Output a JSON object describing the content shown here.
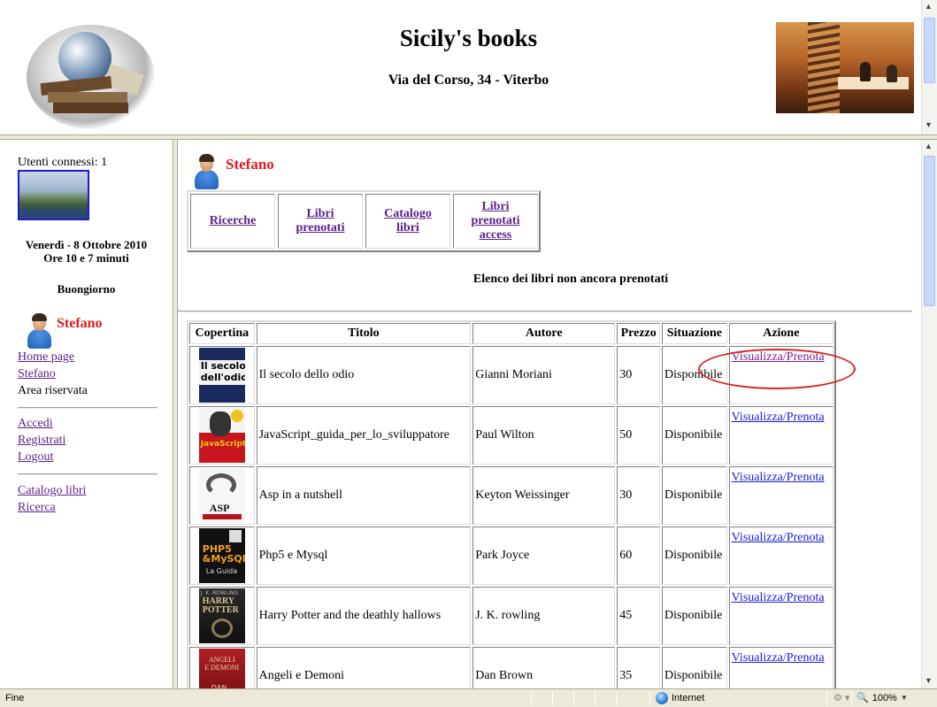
{
  "header": {
    "title": "Sicily's books",
    "address": "Via del Corso, 34 - Viterbo"
  },
  "sidebar": {
    "users_online": "Utenti connessi: 1",
    "date_line1": "Venerdì - 8 Ottobre 2010",
    "date_line2": "Ore 10 e 7 minuti",
    "greeting": "Buongiorno",
    "username": "Stefano",
    "links": {
      "home": "Home page",
      "user": "Stefano",
      "reserved": "Area riservata",
      "login": "Accedi",
      "register": "Registrati",
      "logout": "Logout",
      "catalog": "Catalogo libri",
      "search": "Ricerca"
    }
  },
  "main": {
    "username": "Stefano",
    "menu": [
      {
        "label": "Ricerche"
      },
      {
        "label": "Libri prenotati"
      },
      {
        "label": "Catalogo libri"
      },
      {
        "label": "Libri prenotati access"
      }
    ],
    "heading": "Elenco dei libri non ancora prenotati",
    "table": {
      "headers": [
        "Copertina",
        "Titolo",
        "Autore",
        "Prezzo",
        "Situazione",
        "Azione"
      ],
      "rows": [
        {
          "title": "Il secolo dello odio",
          "author": "Gianni Moriani",
          "price": "30",
          "status": "Disponibile",
          "action": "Visualizza/Prenota",
          "cover": "Il secolo dell'odio"
        },
        {
          "title": "JavaScript_guida_per_lo_sviluppatore",
          "author": "Paul Wilton",
          "price": "50",
          "status": "Disponibile",
          "action": "Visualizza/Prenota",
          "cover": "JavaScript"
        },
        {
          "title": "Asp in a nutshell",
          "author": "Keyton Weissinger",
          "price": "30",
          "status": "Disponibile",
          "action": "Visualizza/Prenota",
          "cover": "ASP"
        },
        {
          "title": "Php5 e Mysql",
          "author": "Park Joyce",
          "price": "60",
          "status": "Disponibile",
          "action": "Visualizza/Prenota",
          "cover": "PHP5 & MySQL"
        },
        {
          "title": "Harry Potter and the deathly hallows",
          "author": "J. K. rowling",
          "price": "45",
          "status": "Disponibile",
          "action": "Visualizza/Prenota",
          "cover": "HARRY POTTER"
        },
        {
          "title": "Angeli e Demoni",
          "author": "Dan Brown",
          "price": "35",
          "status": "Disponibile",
          "action": "Visualizza/Prenota",
          "cover": "ANGELI E DEMONI"
        }
      ]
    }
  },
  "statusbar": {
    "status": "Fine",
    "zone": "Internet",
    "zoom": "100%"
  },
  "colors": {
    "username": "#e31b1b",
    "visited_link": "#5a1e8a",
    "link": "#1a1ad8",
    "highlight": "#d42424"
  }
}
